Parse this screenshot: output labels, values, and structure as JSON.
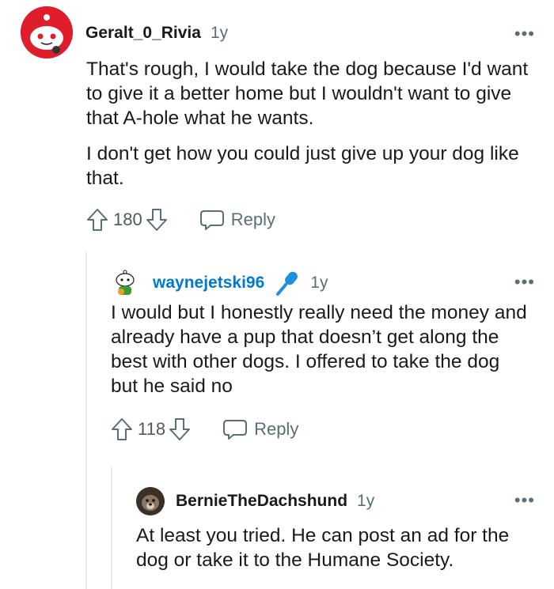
{
  "comments": [
    {
      "username": "Geralt_0_Rivia",
      "age": "1y",
      "paragraphs": [
        "That's rough, I would take the dog because I'd want to give it a better home but I wouldn't want to give that A-hole what he wants.",
        "I don't get how you could just give up your dog like that."
      ],
      "score": "180",
      "reply_label": "Reply",
      "more": "•••"
    },
    {
      "username": "waynejetski96",
      "username_color": "#0079d3",
      "age": "1y",
      "paragraphs": [
        "I would but I honestly really need the money and already have a pup that doesn’t get along the best with other dogs. I offered to take the dog but he said no"
      ],
      "score": "118",
      "reply_label": "Reply",
      "more": "•••"
    },
    {
      "username": "BernieTheDachshund",
      "age": "1y",
      "paragraphs": [
        "At least you tried. He can post an ad for the dog or take it to the Humane Society."
      ],
      "more": "•••"
    }
  ],
  "colors": {
    "meta": "#576f76",
    "thread_line": "#e5ebee",
    "reddit_red": "#ff4500"
  }
}
